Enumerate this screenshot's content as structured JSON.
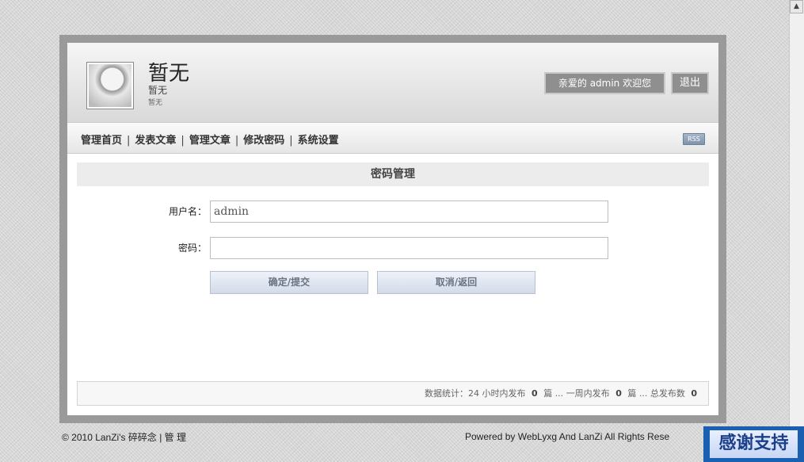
{
  "header": {
    "site_title": "暂无",
    "site_subtitle": "暂无",
    "site_description": "暂无",
    "welcome_label": "亲爱的 admin 欢迎您",
    "logout_label": "退出"
  },
  "nav": {
    "items": [
      {
        "label": "管理首页"
      },
      {
        "label": "发表文章"
      },
      {
        "label": "管理文章"
      },
      {
        "label": "修改密码"
      },
      {
        "label": "系统设置"
      }
    ],
    "separator": "|",
    "rss_label": "RSS"
  },
  "form": {
    "section_title": "密码管理",
    "username_label": "用户名：",
    "username_value": "admin",
    "password_label": "密码：",
    "password_value": "",
    "submit_label": "确定/提交",
    "cancel_label": "取消/返回"
  },
  "stats": {
    "prefix": "数据统计：24 小时内发布",
    "day_count": "0",
    "day_unit": "篇 ...",
    "week_label": "一周内发布",
    "week_count": "0",
    "week_unit": "篇 ...",
    "total_label": "总发布数",
    "total_count": "0"
  },
  "footer": {
    "left_text": "© 2010 LanZi's 碎碎念",
    "separator": "|",
    "admin_link": "管 理",
    "right_text": "Powered by WebLyxg And LanZi All Rights Rese"
  },
  "overlay": {
    "thanks_label": "感谢支持"
  },
  "colors": {
    "frame": "#9a9a9a",
    "header_button": "#8f8f8f",
    "thanks_bg": "#1b5fb0"
  }
}
